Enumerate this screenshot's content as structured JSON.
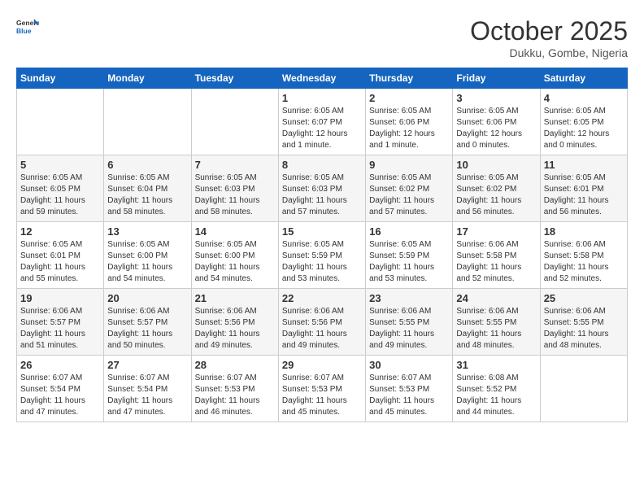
{
  "header": {
    "logo_general": "General",
    "logo_blue": "Blue",
    "month": "October 2025",
    "location": "Dukku, Gombe, Nigeria"
  },
  "days_of_week": [
    "Sunday",
    "Monday",
    "Tuesday",
    "Wednesday",
    "Thursday",
    "Friday",
    "Saturday"
  ],
  "weeks": [
    [
      {
        "day": "",
        "info": ""
      },
      {
        "day": "",
        "info": ""
      },
      {
        "day": "",
        "info": ""
      },
      {
        "day": "1",
        "info": "Sunrise: 6:05 AM\nSunset: 6:07 PM\nDaylight: 12 hours and 1 minute."
      },
      {
        "day": "2",
        "info": "Sunrise: 6:05 AM\nSunset: 6:06 PM\nDaylight: 12 hours and 1 minute."
      },
      {
        "day": "3",
        "info": "Sunrise: 6:05 AM\nSunset: 6:06 PM\nDaylight: 12 hours and 0 minutes."
      },
      {
        "day": "4",
        "info": "Sunrise: 6:05 AM\nSunset: 6:05 PM\nDaylight: 12 hours and 0 minutes."
      }
    ],
    [
      {
        "day": "5",
        "info": "Sunrise: 6:05 AM\nSunset: 6:05 PM\nDaylight: 11 hours and 59 minutes."
      },
      {
        "day": "6",
        "info": "Sunrise: 6:05 AM\nSunset: 6:04 PM\nDaylight: 11 hours and 58 minutes."
      },
      {
        "day": "7",
        "info": "Sunrise: 6:05 AM\nSunset: 6:03 PM\nDaylight: 11 hours and 58 minutes."
      },
      {
        "day": "8",
        "info": "Sunrise: 6:05 AM\nSunset: 6:03 PM\nDaylight: 11 hours and 57 minutes."
      },
      {
        "day": "9",
        "info": "Sunrise: 6:05 AM\nSunset: 6:02 PM\nDaylight: 11 hours and 57 minutes."
      },
      {
        "day": "10",
        "info": "Sunrise: 6:05 AM\nSunset: 6:02 PM\nDaylight: 11 hours and 56 minutes."
      },
      {
        "day": "11",
        "info": "Sunrise: 6:05 AM\nSunset: 6:01 PM\nDaylight: 11 hours and 56 minutes."
      }
    ],
    [
      {
        "day": "12",
        "info": "Sunrise: 6:05 AM\nSunset: 6:01 PM\nDaylight: 11 hours and 55 minutes."
      },
      {
        "day": "13",
        "info": "Sunrise: 6:05 AM\nSunset: 6:00 PM\nDaylight: 11 hours and 54 minutes."
      },
      {
        "day": "14",
        "info": "Sunrise: 6:05 AM\nSunset: 6:00 PM\nDaylight: 11 hours and 54 minutes."
      },
      {
        "day": "15",
        "info": "Sunrise: 6:05 AM\nSunset: 5:59 PM\nDaylight: 11 hours and 53 minutes."
      },
      {
        "day": "16",
        "info": "Sunrise: 6:05 AM\nSunset: 5:59 PM\nDaylight: 11 hours and 53 minutes."
      },
      {
        "day": "17",
        "info": "Sunrise: 6:06 AM\nSunset: 5:58 PM\nDaylight: 11 hours and 52 minutes."
      },
      {
        "day": "18",
        "info": "Sunrise: 6:06 AM\nSunset: 5:58 PM\nDaylight: 11 hours and 52 minutes."
      }
    ],
    [
      {
        "day": "19",
        "info": "Sunrise: 6:06 AM\nSunset: 5:57 PM\nDaylight: 11 hours and 51 minutes."
      },
      {
        "day": "20",
        "info": "Sunrise: 6:06 AM\nSunset: 5:57 PM\nDaylight: 11 hours and 50 minutes."
      },
      {
        "day": "21",
        "info": "Sunrise: 6:06 AM\nSunset: 5:56 PM\nDaylight: 11 hours and 49 minutes."
      },
      {
        "day": "22",
        "info": "Sunrise: 6:06 AM\nSunset: 5:56 PM\nDaylight: 11 hours and 49 minutes."
      },
      {
        "day": "23",
        "info": "Sunrise: 6:06 AM\nSunset: 5:55 PM\nDaylight: 11 hours and 49 minutes."
      },
      {
        "day": "24",
        "info": "Sunrise: 6:06 AM\nSunset: 5:55 PM\nDaylight: 11 hours and 48 minutes."
      },
      {
        "day": "25",
        "info": "Sunrise: 6:06 AM\nSunset: 5:55 PM\nDaylight: 11 hours and 48 minutes."
      }
    ],
    [
      {
        "day": "26",
        "info": "Sunrise: 6:07 AM\nSunset: 5:54 PM\nDaylight: 11 hours and 47 minutes."
      },
      {
        "day": "27",
        "info": "Sunrise: 6:07 AM\nSunset: 5:54 PM\nDaylight: 11 hours and 47 minutes."
      },
      {
        "day": "28",
        "info": "Sunrise: 6:07 AM\nSunset: 5:53 PM\nDaylight: 11 hours and 46 minutes."
      },
      {
        "day": "29",
        "info": "Sunrise: 6:07 AM\nSunset: 5:53 PM\nDaylight: 11 hours and 45 minutes."
      },
      {
        "day": "30",
        "info": "Sunrise: 6:07 AM\nSunset: 5:53 PM\nDaylight: 11 hours and 45 minutes."
      },
      {
        "day": "31",
        "info": "Sunrise: 6:08 AM\nSunset: 5:52 PM\nDaylight: 11 hours and 44 minutes."
      },
      {
        "day": "",
        "info": ""
      }
    ]
  ]
}
